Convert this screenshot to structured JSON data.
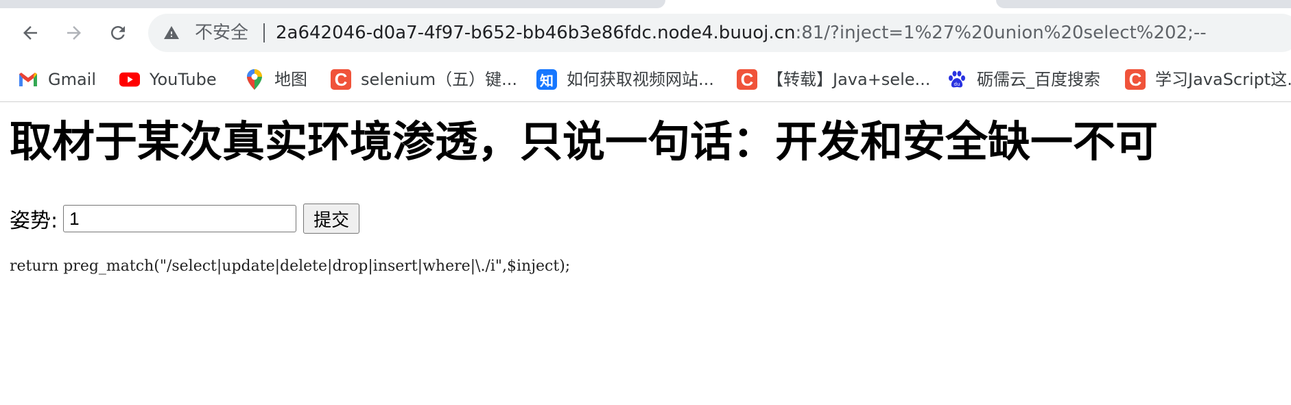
{
  "browser": {
    "omnibox": {
      "security_label": "不安全",
      "url_host": "2a642046-d0a7-4f97-b652-bb46b3e86fdc.node4.buuoj.cn",
      "url_rest": ":81/?inject=1%27%20union%20select%202;--"
    },
    "bookmarks": [
      {
        "label": "Gmail",
        "icon": "gmail-icon"
      },
      {
        "label": "YouTube",
        "icon": "youtube-icon"
      },
      {
        "label": "地图",
        "icon": "maps-icon"
      },
      {
        "label": "selenium（五）键...",
        "icon": "csdn-icon"
      },
      {
        "label": "如何获取视频网站...",
        "icon": "zhihu-icon"
      },
      {
        "label": "【转载】Java+sele...",
        "icon": "csdn-icon"
      },
      {
        "label": "砺儒云_百度搜索",
        "icon": "baidu-icon"
      },
      {
        "label": "学习JavaScript这...",
        "icon": "csdn-icon"
      }
    ],
    "csdn_glyph": "C",
    "zhihu_glyph": "知",
    "colors": {
      "chrome_bg": "#dee1e6",
      "omnibox_bg": "#f1f3f4",
      "csdn_red": "#f0533a",
      "zhihu_blue": "#1677ff",
      "youtube_red": "#ff0000"
    }
  },
  "page": {
    "title": "取材于某次真实环境渗透，只说一句话：开发和安全缺一不可",
    "form": {
      "label": "姿势:",
      "input_value": "1",
      "submit_label": "提交"
    },
    "code": "return preg_match(\"/select|update|delete|drop|insert|where|\\./i\",$inject);"
  }
}
